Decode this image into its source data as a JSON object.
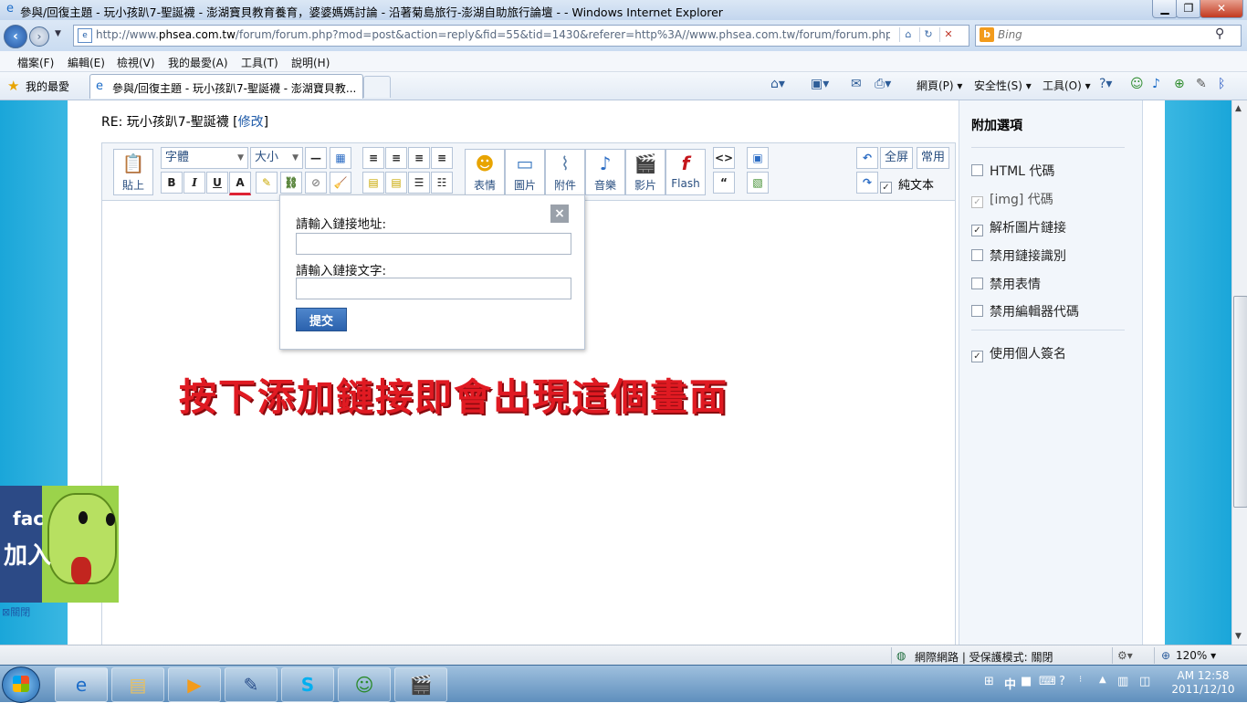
{
  "window": {
    "title": "參與/回復主題 - 玩小孩趴7-聖誕襪 - 澎湖寶貝教育養育，婆婆媽媽討論 - 沿著菊島旅行-澎湖自助旅行論壇 - - Windows Internet Explorer"
  },
  "address_bar": {
    "url_prefix": "http://www.",
    "url_domain": "phsea.com.tw",
    "url_rest": "/forum/forum.php?mod=post&action=reply&fid=55&tid=1430&referer=http%3A//www.phsea.com.tw/forum/forum.php%3F",
    "search_placeholder": "Bing"
  },
  "menu": [
    "檔案(F)",
    "編輯(E)",
    "檢視(V)",
    "我的最愛(A)",
    "工具(T)",
    "說明(H)"
  ],
  "favorites_label": "我的最愛",
  "tab": {
    "title": "參與/回復主題 - 玩小孩趴7-聖誕襪 - 澎湖寶貝教..."
  },
  "command_bar": {
    "page": "網頁(P)",
    "safety": "安全性(S)",
    "tools": "工具(O)"
  },
  "post": {
    "title": "RE: 玩小孩趴7-聖誕襪",
    "edit_link": "修改"
  },
  "editor": {
    "paste_label": "貼上",
    "font_select": "字體",
    "size_select": "大小",
    "emoticon_label": "表情",
    "image_label": "圖片",
    "attach_label": "附件",
    "music_label": "音樂",
    "video_label": "影片",
    "flash_label": "Flash",
    "fullscreen_label": "全屏",
    "common_label": "常用",
    "plaintext_label": "純文本"
  },
  "link_popup": {
    "url_label": "請輸入鏈接地址:",
    "text_label": "請輸入鏈接文字:",
    "url_value": "",
    "text_value": "",
    "submit_label": "提交"
  },
  "annotation": "按下添加鏈接即會出現這個畫面",
  "sidebar": {
    "title": "附加選項",
    "options": [
      {
        "label": "HTML 代碼",
        "checked": false
      },
      {
        "label": "[img] 代碼",
        "checked": true
      },
      {
        "label": "解析圖片鏈接",
        "checked": true
      },
      {
        "label": "禁用鏈接識別",
        "checked": false
      },
      {
        "label": "禁用表情",
        "checked": false
      },
      {
        "label": "禁用編輯器代碼",
        "checked": false
      }
    ],
    "signature": {
      "label": "使用個人簽名",
      "checked": true
    }
  },
  "fb_ad": {
    "line1": "fac",
    "line2": "加入",
    "close_label": "關閉"
  },
  "status_bar": {
    "zone": "網際網路 | 受保護模式: 關閉",
    "zoom": "120%"
  },
  "taskbar": {
    "time": "AM 12:58",
    "date": "2011/12/10",
    "lang": "中"
  }
}
